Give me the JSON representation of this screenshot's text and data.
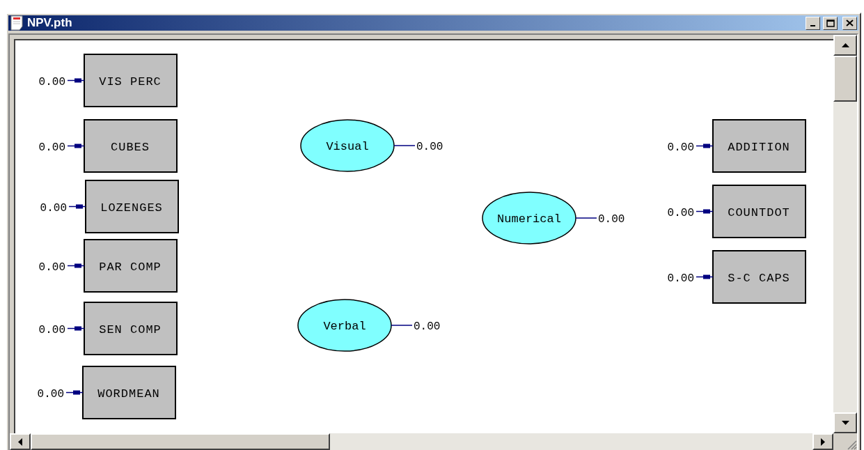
{
  "window": {
    "title": "NPV.pth"
  },
  "observed_variables": [
    {
      "label": "VIS PERC",
      "error": "0.00"
    },
    {
      "label": "CUBES",
      "error": "0.00"
    },
    {
      "label": "LOZENGES",
      "error": "0.00"
    },
    {
      "label": "PAR COMP",
      "error": "0.00"
    },
    {
      "label": "SEN COMP",
      "error": "0.00"
    },
    {
      "label": "WORDMEAN",
      "error": "0.00"
    },
    {
      "label": "ADDITION",
      "error": "0.00"
    },
    {
      "label": "COUNTDOT",
      "error": "0.00"
    },
    {
      "label": "S-C CAPS",
      "error": "0.00"
    }
  ],
  "latent_variables": [
    {
      "label": "Visual",
      "error": "0.00"
    },
    {
      "label": "Verbal",
      "error": "0.00"
    },
    {
      "label": "Numerical",
      "error": "0.00"
    }
  ]
}
